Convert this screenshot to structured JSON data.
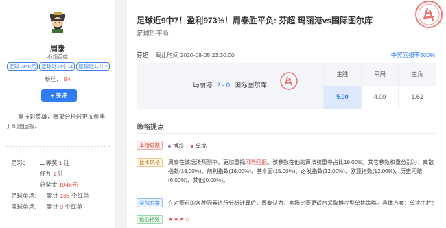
{
  "profile": {
    "name": "周泰",
    "subtitle": "小炮英雄",
    "badges": [
      "足彩1946元",
      "足球近14中11",
      "篮球近10中7"
    ],
    "fans_label": "粉丝：",
    "fans_value": "94",
    "follow_label": "+ 关注",
    "description": "竞技彩英雄，赛果分析时更加侧重于风险回报。",
    "stats": {
      "zucai_label": "足彩：",
      "second_prize_text": "二等奖",
      "second_prize_count": "1",
      "second_prize_unit": "注",
      "renjiu_text": "任九",
      "renjiu_count": "1",
      "renjiu_unit": "注",
      "total_text": "总奖金",
      "total_value": "1946元",
      "football_label": "足球单场：",
      "football_text": "累计",
      "football_count": "186",
      "football_unit": "个红单",
      "basketball_label": "篮球单场：",
      "basketball_text": "累计",
      "basketball_count": "9",
      "basketball_unit": "个红单"
    }
  },
  "article": {
    "title": "足球近9中7！盈利973%！周泰胜平负: 芬超 玛丽港vs国际图尔库",
    "category": "足球胜平负",
    "league": "芬超",
    "deadline": "截止时间 2020-08-05 23:30:00",
    "hit_rate": "中奖回报率500%",
    "home_team": "玛丽港",
    "score": "2 - 0",
    "away_team": "国际图尔库",
    "odds": [
      {
        "label": "主胜",
        "value": "5.00",
        "active": true
      },
      {
        "label": "平局",
        "value": "4.00",
        "active": false
      },
      {
        "label": "主负",
        "value": "1.62",
        "active": false
      }
    ],
    "section_title": "策略提点",
    "strategy": {
      "tag1": "本场思路",
      "item1a": "博冷",
      "item1b": "单挑",
      "tag2": "技术风格",
      "text2a": "周泰在该玩法预测中，更加重视",
      "text2_highlight": "风险回报",
      "text2b": "。该参数在他的算法权重中占比19.00%。其它参数权重分别为：离散指数(18.00%)、前利指数(18.00%)、基本面(15.00%)、必发指数(12.00%)、欧亚指数(12.00%)、历史同赔(6.00%)、其他(0.00%)。",
      "tag3": "实战方案",
      "text3": "在对赛前的各种因素进行分析计算后，周泰认为，本场比赛更适合采取博冷型单挑策略。具体方案：单挑主胜！",
      "tag4": "信心指数",
      "stars": "★★★☆"
    }
  },
  "colors": {
    "accent": "#2f7cf6",
    "red": "#e04a4a"
  }
}
